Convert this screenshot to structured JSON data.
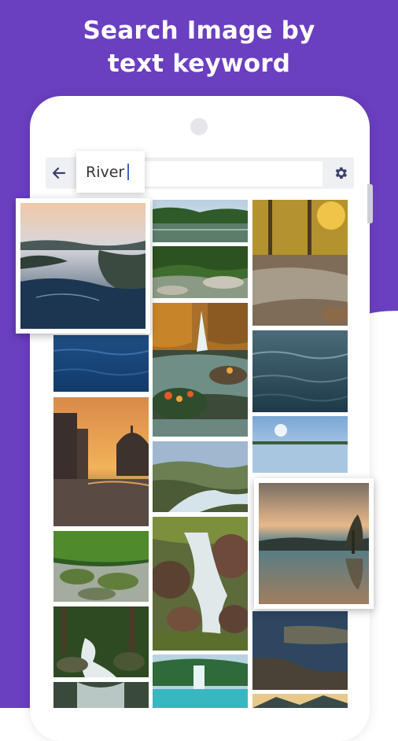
{
  "headline": {
    "line1": "Search Image by",
    "line2": "text keyword"
  },
  "search": {
    "query": "River",
    "back_icon": "arrow-left-icon",
    "settings_icon": "gear-icon"
  },
  "colors": {
    "brand_purple": "#6a3fc0",
    "caret_blue": "#3f66c8",
    "icon_dark": "#3a3f6e"
  },
  "results": [
    {
      "id": "aerial-river-sunrise",
      "theme": "river"
    },
    {
      "id": "lake-forest-reflection",
      "theme": "lake"
    },
    {
      "id": "green-river-rocks",
      "theme": "river"
    },
    {
      "id": "forest-stream-autumn",
      "theme": "stream"
    },
    {
      "id": "autumn-waterfall-rocks",
      "theme": "waterfall"
    },
    {
      "id": "blue-water-surface",
      "theme": "water"
    },
    {
      "id": "rippled-water-dark",
      "theme": "water"
    },
    {
      "id": "venice-canal-sunset",
      "theme": "canal"
    },
    {
      "id": "calm-lake-sky",
      "theme": "lake"
    },
    {
      "id": "valley-river-rapids",
      "theme": "river"
    },
    {
      "id": "misty-lake-tree",
      "theme": "lake"
    },
    {
      "id": "mossy-stream-rocks",
      "theme": "stream"
    },
    {
      "id": "cascade-rocky-stream",
      "theme": "stream"
    },
    {
      "id": "forest-creek",
      "theme": "creek"
    },
    {
      "id": "rocky-shore-lake",
      "theme": "lake"
    },
    {
      "id": "tropical-waterfall-pool",
      "theme": "waterfall"
    },
    {
      "id": "river-bottom-left",
      "theme": "river"
    },
    {
      "id": "mountain-lake-bottom",
      "theme": "lake"
    }
  ]
}
